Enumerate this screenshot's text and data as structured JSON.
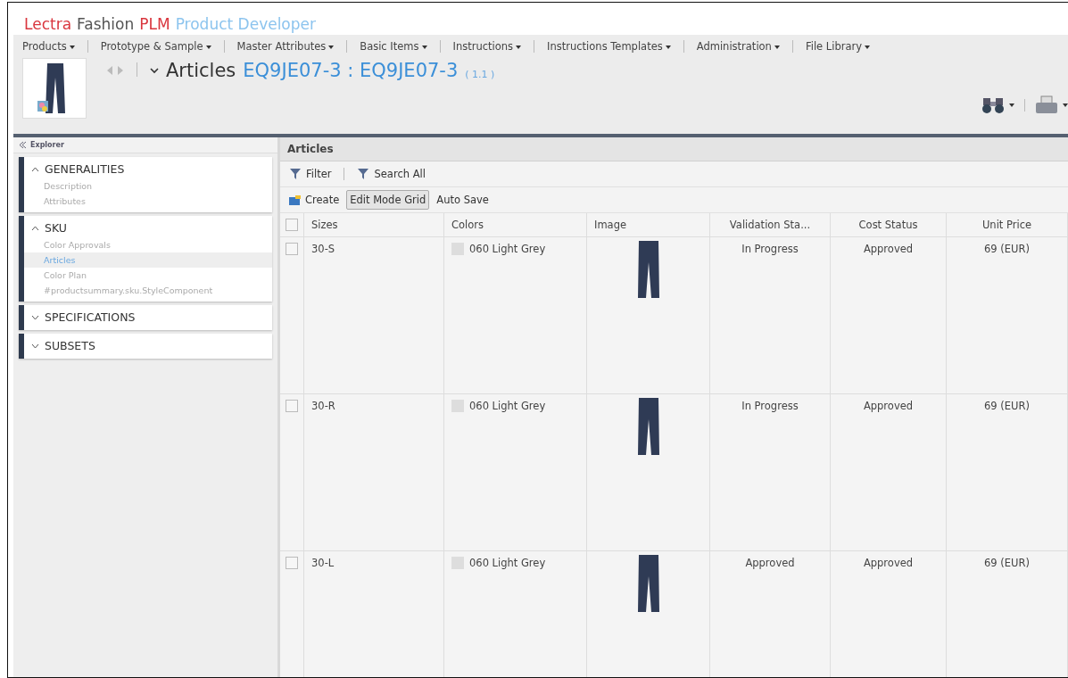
{
  "app_title": [
    {
      "text": "Lectra",
      "color": "#d9363e"
    },
    {
      "text": "Fashion",
      "color": "#555555"
    },
    {
      "text": "PLM",
      "color": "#d9363e"
    },
    {
      "text": "Product Developer",
      "color": "#8cc4ee"
    }
  ],
  "menu": [
    "Products",
    "Prototype & Sample",
    "Master Attributes",
    "Basic Items",
    "Instructions",
    "Instructions Templates",
    "Administration",
    "File Library"
  ],
  "breadcrumb": {
    "type": "Articles",
    "name": "EQ9JE07-3 : EQ9JE07-3",
    "version": "( 1.1 )"
  },
  "explorer": {
    "title": "Explorer",
    "sections": [
      {
        "title": "GENERALITIES",
        "expanded": true,
        "items": [
          {
            "label": "Description",
            "selected": false
          },
          {
            "label": "Attributes",
            "selected": false
          }
        ]
      },
      {
        "title": "SKU",
        "expanded": true,
        "items": [
          {
            "label": "Color Approvals",
            "selected": false
          },
          {
            "label": "Articles",
            "selected": true
          },
          {
            "label": "Color Plan",
            "selected": false
          },
          {
            "label": "#productsummary.sku.StyleComponent",
            "selected": false
          }
        ]
      },
      {
        "title": "SPECIFICATIONS",
        "expanded": false
      },
      {
        "title": "SUBSETS",
        "expanded": false
      }
    ]
  },
  "panel": {
    "title": "Articles",
    "filter": "Filter",
    "search_all": "Search All",
    "create": "Create",
    "edit_mode_grid": "Edit Mode Grid",
    "auto_save": "Auto Save"
  },
  "table": {
    "select_all_checked": false,
    "columns": [
      "Sizes",
      "Colors",
      "Image",
      "Validation Sta...",
      "Cost Status",
      "Unit Price"
    ],
    "rows": [
      {
        "checked": false,
        "size": "30-S",
        "color_name": "060 Light Grey",
        "validation": "In Progress",
        "cost": "Approved",
        "price": "69 (EUR)"
      },
      {
        "checked": false,
        "size": "30-R",
        "color_name": "060 Light Grey",
        "validation": "In Progress",
        "cost": "Approved",
        "price": "69 (EUR)"
      },
      {
        "checked": false,
        "size": "30-L",
        "color_name": "060 Light Grey",
        "validation": "Approved",
        "cost": "Approved",
        "price": "69 (EUR)"
      }
    ]
  }
}
